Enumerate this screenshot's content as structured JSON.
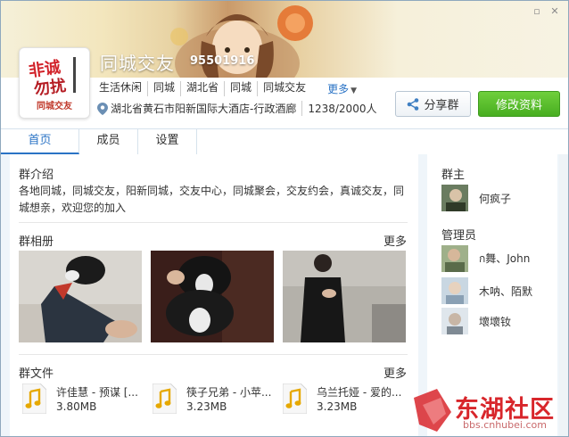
{
  "window": {
    "minimize_icon": "minimize-icon",
    "close_icon": "close-icon"
  },
  "header": {
    "title": "同城交友",
    "group_id": "95501916",
    "logo_text": "同城交友",
    "tags": [
      "生活休闲",
      "同城",
      "湖北省",
      "同城",
      "同城交友"
    ],
    "more_label": "更多",
    "location": "湖北省黄石市阳新国际大酒店-行政酒廊",
    "member_count": "1238/2000人",
    "share_label": "分享群",
    "edit_label": "修改资料"
  },
  "tabs": [
    {
      "label": "首页",
      "active": true
    },
    {
      "label": "成员",
      "active": false
    },
    {
      "label": "设置",
      "active": false
    }
  ],
  "intro": {
    "title": "群介绍",
    "text": "各地同城，同城交友，阳新同城，交友中心，同城聚会，交友约会，真诚交友，同城想亲，欢迎您的加入"
  },
  "album": {
    "title": "群相册",
    "more_label": "更多",
    "photos": [
      "photo-dog-leg",
      "photo-puppy",
      "photo-person"
    ]
  },
  "files": {
    "title": "群文件",
    "more_label": "更多",
    "items": [
      {
        "name": "许佳慧 - 预谋 [...",
        "size": "3.80MB"
      },
      {
        "name": "筷子兄弟 - 小苹...",
        "size": "3.23MB"
      },
      {
        "name": "乌兰托娅 - 爱的...",
        "size": "3.23MB"
      }
    ]
  },
  "sidebar": {
    "owner_title": "群主",
    "owner": {
      "name": "何疯子"
    },
    "admins_title": "管理员",
    "admins": [
      {
        "name": "ก舞、John"
      },
      {
        "name": "木呐、陌默"
      },
      {
        "name": "壞壞钕"
      }
    ]
  },
  "watermark": {
    "text": "东湖社区",
    "url": "bbs.cnhubei.com"
  },
  "colors": {
    "accent": "#2a73c5",
    "edit_button": "#4cb124",
    "watermark": "#d8262b"
  }
}
